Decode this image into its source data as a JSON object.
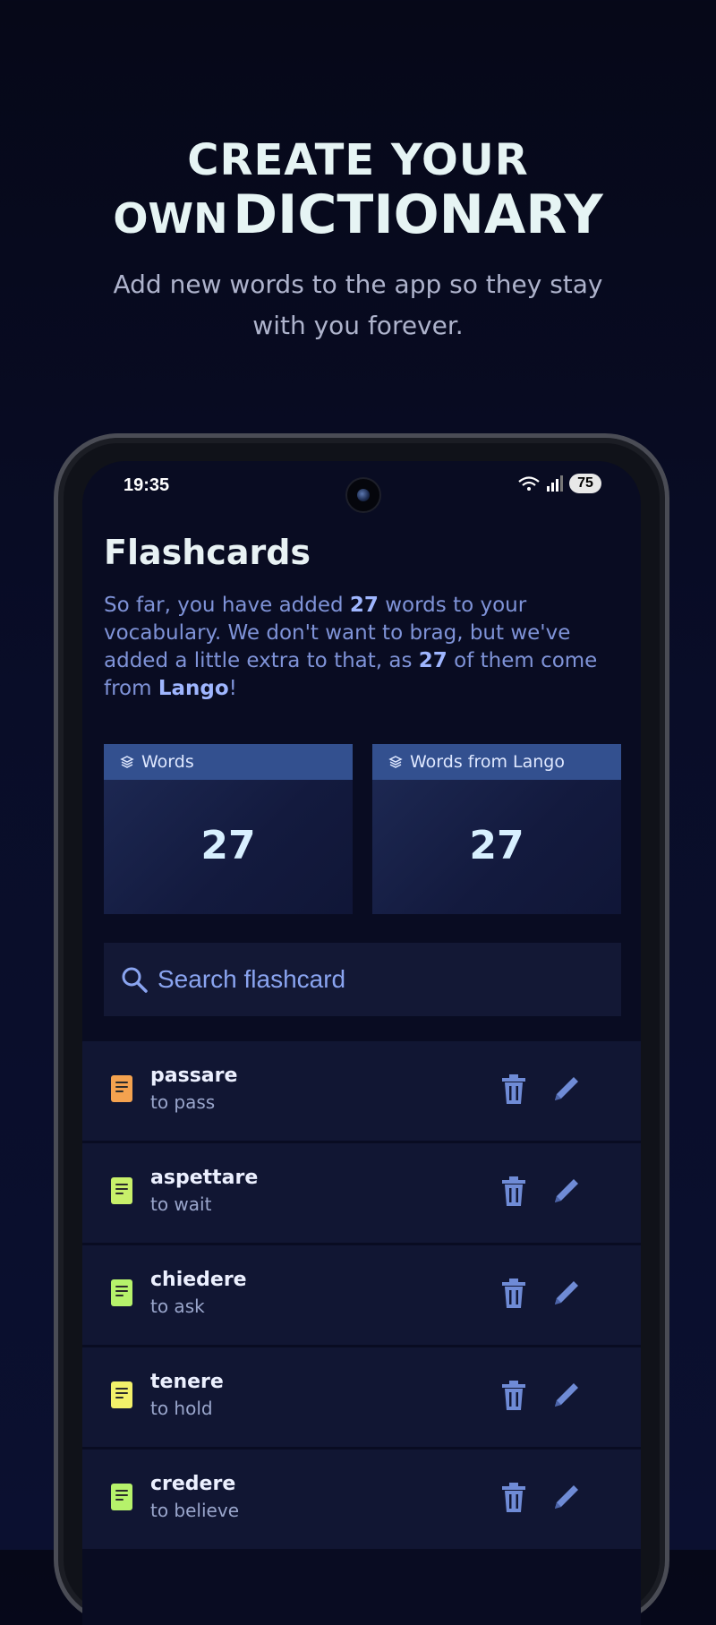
{
  "hero": {
    "title_line1": "CREATE YOUR",
    "title_line2_small": "OWN",
    "title_line2_big": "DICTIONARY",
    "subtitle": "Add new words to the app so they stay with you forever."
  },
  "status_bar": {
    "time": "19:35",
    "battery": "75"
  },
  "page": {
    "title": "Flashcards",
    "intro_parts": {
      "p1": "So far, you have added ",
      "count1": "27",
      "p2": " words to your vocabulary. We don't want to brag, but we've added a little extra to that, as ",
      "count2": "27",
      "p3": " of them come from ",
      "brand": "Lango",
      "p4": "!"
    }
  },
  "stats": [
    {
      "label": "Words",
      "value": "27"
    },
    {
      "label": "Words from Lango",
      "value": "27"
    }
  ],
  "search": {
    "placeholder": "Search flashcard"
  },
  "flashcards": [
    {
      "word": "passare",
      "translation": "to pass",
      "icon_color": "#f4a24f"
    },
    {
      "word": "aspettare",
      "translation": "to wait",
      "icon_color": "#c8f06a"
    },
    {
      "word": "chiedere",
      "translation": "to ask",
      "icon_color": "#b6f26b"
    },
    {
      "word": "tenere",
      "translation": "to hold",
      "icon_color": "#f2f06a"
    },
    {
      "word": "credere",
      "translation": "to believe",
      "icon_color": "#b6f26b"
    }
  ],
  "colors": {
    "accent": "#8aa4f0",
    "action_icon": "#6f8bd6"
  }
}
